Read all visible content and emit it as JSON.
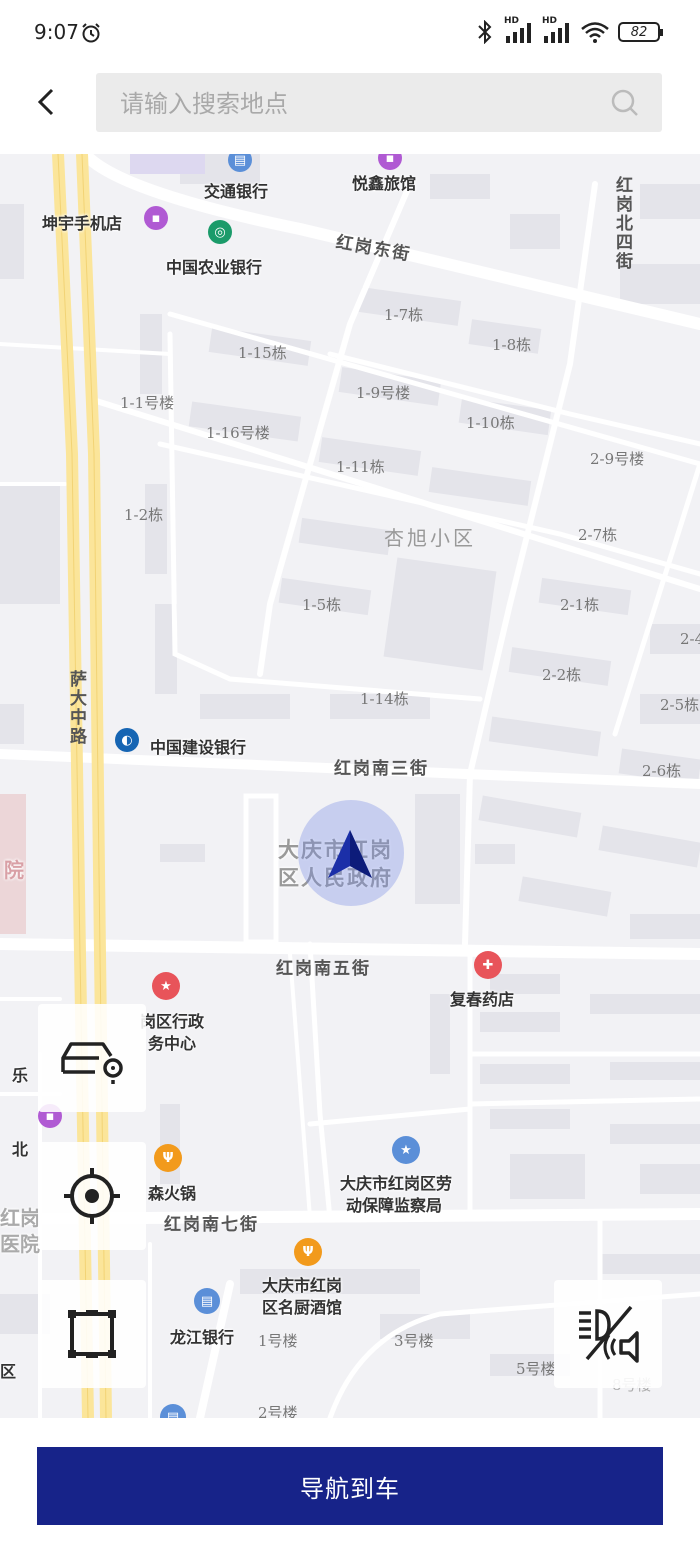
{
  "status_bar": {
    "time": "9:07",
    "battery": "82",
    "signal_label_1": "HD",
    "signal_label_2": "HD"
  },
  "search": {
    "placeholder": "请输入搜索地点"
  },
  "map": {
    "streets": {
      "hong_gang_dong": "红岗东街",
      "hong_gang_nan_san": "红岗南三街",
      "hong_gang_nan_wu": "红岗南五街",
      "hong_gang_nan_qi": "红岗南七街",
      "hong_gang_bei_si": "红岗北四街",
      "sa_da_zhong": "萨大中路"
    },
    "area": "杏旭小区",
    "pois": {
      "jiaotong_bank": "交通银行",
      "yuexin_hotel": "悦鑫旅馆",
      "kunyu_phone": "坤宇手机店",
      "nongye_bank": "中国农业银行",
      "jianshe_bank": "中国建设银行",
      "government_1": "大庆市红岗",
      "government_2": "区人民政府",
      "fuchun_pharmacy": "复春药店",
      "admin_center_1": "岗区行政",
      "admin_center_2": "务中心",
      "hotpot": "森火锅",
      "labor_1": "大庆市红岗区劳",
      "labor_2": "动保障监察局",
      "restaurant_1": "大庆市红岗",
      "restaurant_2": "区名厨酒馆",
      "longjiang_bank": "龙江银行",
      "left_edge_1": "乐",
      "left_edge_2": "北",
      "left_edge_3": "红岗",
      "left_edge_4": "医院",
      "left_edge_5": "院",
      "left_edge_6": "区"
    },
    "buildings": [
      "1-7栋",
      "1-8栋",
      "1-15栋",
      "1-9号楼",
      "1-1号楼",
      "1-16号楼",
      "1-10栋",
      "2-9号楼",
      "1-11栋",
      "1-2栋",
      "2-7栋",
      "1-5栋",
      "2-1栋",
      "2-4",
      "2-2栋",
      "1-14栋",
      "2-5栋",
      "2-6栋",
      "1号楼",
      "3号楼",
      "5号楼",
      "8号楼",
      "2号楼"
    ]
  },
  "footer": {
    "nav_button": "导航到车"
  }
}
